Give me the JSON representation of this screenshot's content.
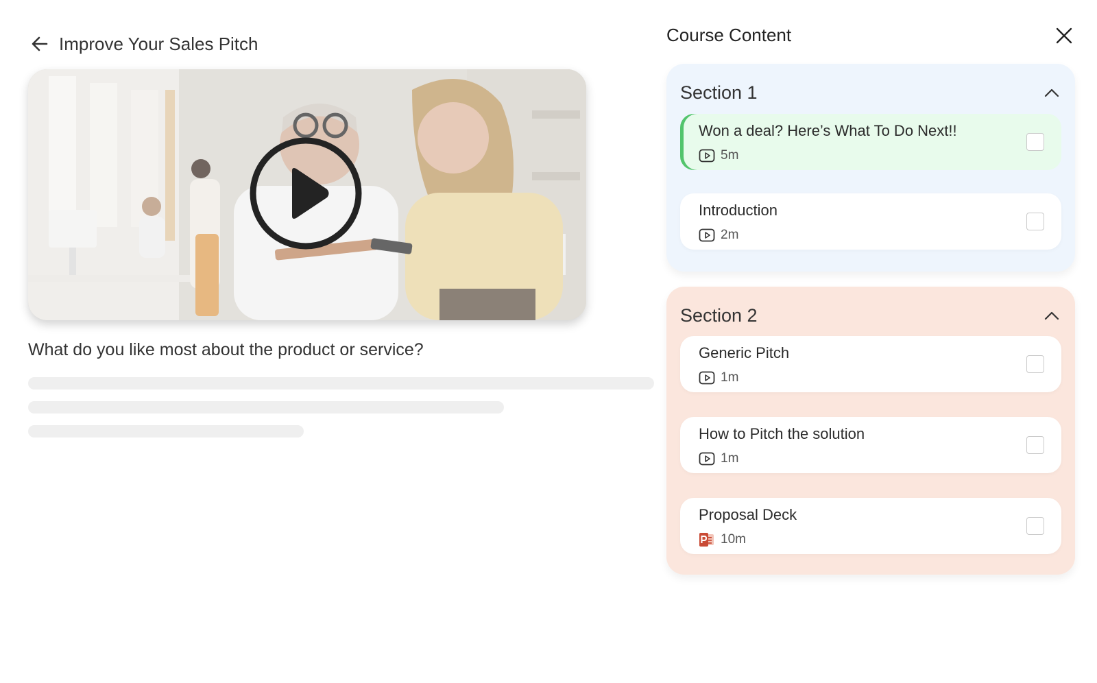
{
  "header": {
    "title": "Improve Your Sales Pitch"
  },
  "main": {
    "question": "What do you like most about the product or service?"
  },
  "course": {
    "title": "Course Content",
    "sections": [
      {
        "title": "Section 1",
        "items": [
          {
            "title": "Won a deal? Here’s What To Do Next!!",
            "duration": "5m",
            "icon": "video-icon"
          },
          {
            "title": "Introduction",
            "duration": "2m",
            "icon": "video-icon"
          }
        ]
      },
      {
        "title": "Section 2",
        "items": [
          {
            "title": "Generic Pitch",
            "duration": "1m",
            "icon": "video-icon"
          },
          {
            "title": "How to Pitch the solution",
            "duration": "1m",
            "icon": "video-icon"
          },
          {
            "title": "Proposal Deck",
            "duration": "10m",
            "icon": "powerpoint-icon"
          }
        ]
      }
    ]
  },
  "colors": {
    "section1_bg": "#eef5fd",
    "section2_bg": "#fbe6dd",
    "active_item_bg": "#e8fbec",
    "active_accent": "#52c46c",
    "powerpoint_red": "#c94a35"
  }
}
